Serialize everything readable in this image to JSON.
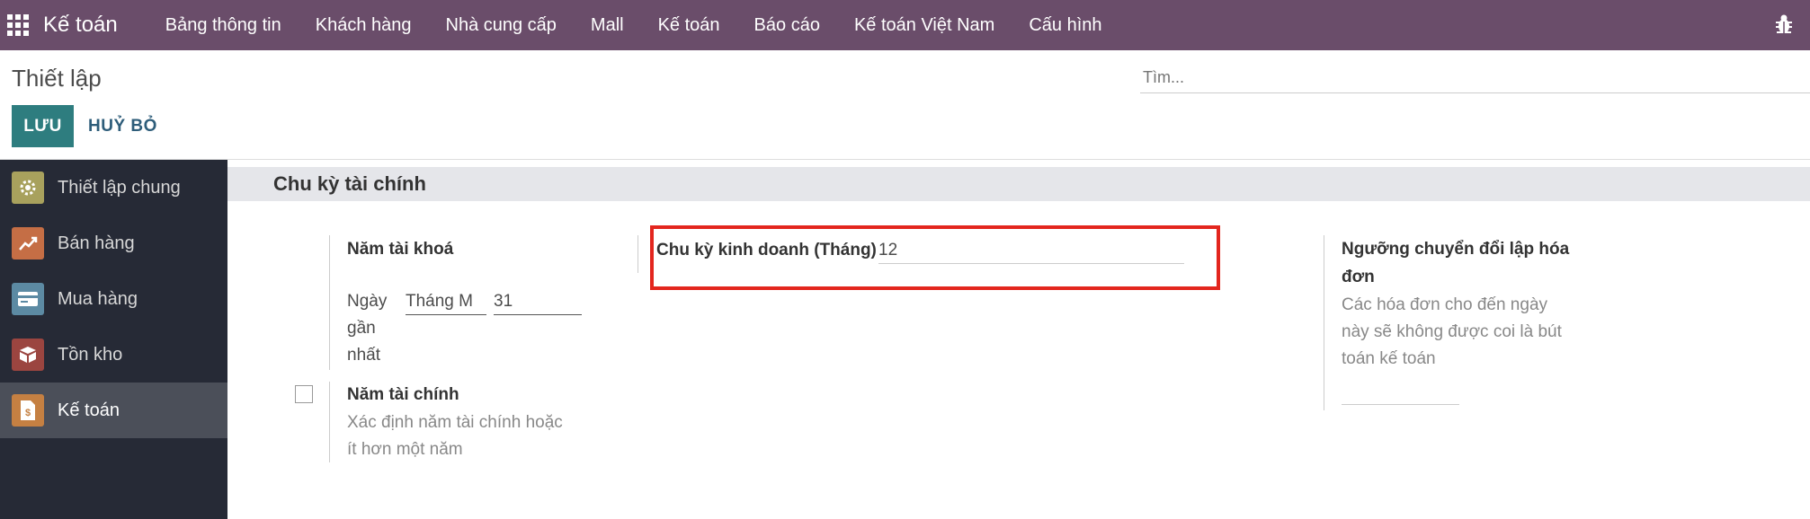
{
  "navbar": {
    "app_name": "Kế toán",
    "items": [
      "Bảng thông tin",
      "Khách hàng",
      "Nhà cung cấp",
      "Mall",
      "Kế toán",
      "Báo cáo",
      "Kế toán Việt Nam",
      "Cấu hình"
    ]
  },
  "control_panel": {
    "title": "Thiết lập",
    "search_placeholder": "Tìm...",
    "save_label": "LƯU",
    "discard_label": "HUỶ BỎ"
  },
  "sidebar": {
    "items": [
      {
        "label": "Thiết lập chung",
        "icon": "gear-icon",
        "color": "#a8a15d"
      },
      {
        "label": "Bán hàng",
        "icon": "chart-icon",
        "color": "#c56e45"
      },
      {
        "label": "Mua hàng",
        "icon": "credit-card-icon",
        "color": "#5c8aa3"
      },
      {
        "label": "Tồn kho",
        "icon": "box-icon",
        "color": "#9b4540"
      },
      {
        "label": "Kế toán",
        "icon": "invoice-icon",
        "color": "#c58042",
        "active": true
      }
    ]
  },
  "section": {
    "title": "Chu kỳ tài chính",
    "fiscal_year": {
      "label": "Năm tài khoá",
      "last_day_label_line1": "Ngày",
      "last_day_label_line2": "gần",
      "last_day_label_line3": "nhất",
      "month_value": "Tháng M",
      "day_value": "31"
    },
    "fiscal_years": {
      "label": "Năm tài chính",
      "desc_line1": "Xác định năm tài chính hoặc",
      "desc_line2": "ít hơn một năm"
    },
    "business_cycle": {
      "label": "Chu kỳ kinh doanh (Tháng)",
      "value": "12"
    },
    "invoicing_threshold": {
      "label_line1": "Ngưỡng chuyển đổi lập hóa",
      "label_line2": "đơn",
      "desc_line1": "Các hóa đơn cho đến ngày",
      "desc_line2": "này sẽ không được coi là bút",
      "desc_line3": "toán kế toán",
      "value": ""
    }
  },
  "colors": {
    "navbar": "#6a4d6a",
    "primary_button": "#2e7d7f",
    "sidebar": "#262a36",
    "highlight": "#e3261e"
  }
}
